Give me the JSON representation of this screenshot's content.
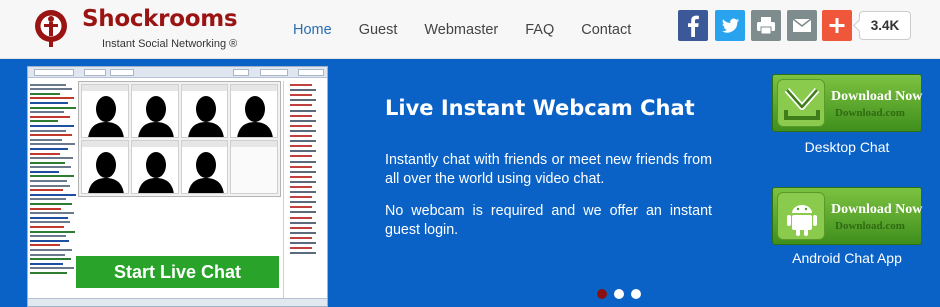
{
  "header": {
    "brand": "Shockrooms",
    "tagline": "Instant Social Networking ®",
    "nav": [
      {
        "label": "Home",
        "active": true
      },
      {
        "label": "Guest",
        "active": false
      },
      {
        "label": "Webmaster",
        "active": false
      },
      {
        "label": "FAQ",
        "active": false
      },
      {
        "label": "Contact",
        "active": false
      }
    ],
    "share": {
      "buttons": [
        "facebook-icon",
        "twitter-icon",
        "print-icon",
        "email-icon",
        "plus-icon"
      ],
      "count": "3.4K"
    }
  },
  "banner": {
    "start_button": "Start Live Chat",
    "headline": "Live Instant Webcam Chat",
    "paragraph1": "Instantly chat with friends or meet new friends from all over the world using video chat.",
    "paragraph2": "No webcam is required and we offer an instant guest login.",
    "downloads": [
      {
        "title": "Download Now",
        "subtitle": "Download.com",
        "label": "Desktop Chat",
        "icon": "download-arrow-icon"
      },
      {
        "title": "Download Now",
        "subtitle": "Download.com",
        "label": "Android Chat App",
        "icon": "android-icon"
      }
    ],
    "slides": 3,
    "active_slide": 1
  },
  "colors": {
    "brand": "#9b1414",
    "banner_bg": "#0a62c7",
    "start_button": "#29a329",
    "nav_active": "#2a6db3"
  }
}
